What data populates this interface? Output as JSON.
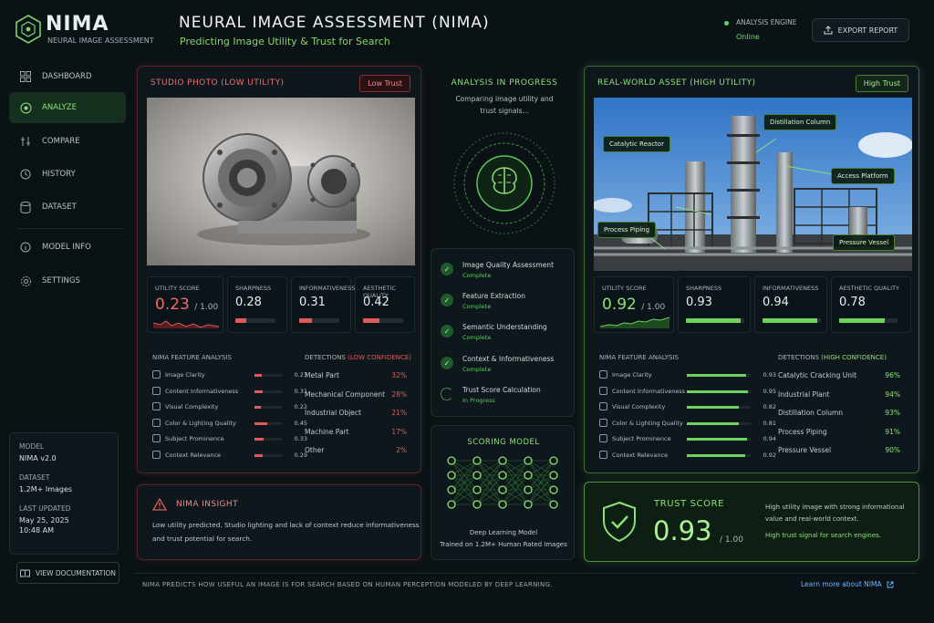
{
  "app": {
    "name": "NIMA",
    "subtitle": "NEURAL IMAGE ASSESSMENT"
  },
  "header": {
    "title": "NEURAL IMAGE ASSESSMENT (NIMA)",
    "subtitle": "Predicting Image Utility & Trust for Search",
    "engine_label": "ANALYSIS ENGINE",
    "engine_status": "Online",
    "export_label": "EXPORT REPORT"
  },
  "sidebar": {
    "items": [
      {
        "label": "DASHBOARD",
        "icon": "grid-icon"
      },
      {
        "label": "ANALYZE",
        "icon": "target-icon",
        "active": true
      },
      {
        "label": "COMPARE",
        "icon": "compare-icon"
      },
      {
        "label": "HISTORY",
        "icon": "history-icon"
      },
      {
        "label": "DATASET",
        "icon": "database-icon"
      },
      {
        "label": "MODEL INFO",
        "icon": "info-icon"
      },
      {
        "label": "SETTINGS",
        "icon": "gear-icon"
      }
    ],
    "model_label": "MODEL",
    "model_value": "NIMA v2.0",
    "dataset_label": "DATASET",
    "dataset_value": "1.2M+ Images",
    "updated_label": "LAST UPDATED",
    "updated_date": "May 25, 2025",
    "updated_time": "10:48 AM",
    "doc_button": "VIEW DOCUMENTATION"
  },
  "left_card": {
    "title": "STUDIO PHOTO (LOW UTILITY)",
    "tag": "Low Trust",
    "utility_label": "UTILITY SCORE",
    "utility_value": "0.23",
    "utility_max": "/ 1.00",
    "metrics": [
      {
        "label": "SHARPNESS",
        "value": "0.28",
        "fill": 0.28
      },
      {
        "label": "INFORMATIVENESS",
        "value": "0.31",
        "fill": 0.31
      },
      {
        "label": "AESTHETIC QUALITY",
        "value": "0.42",
        "fill": 0.42
      }
    ],
    "features_title": "NIMA FEATURE ANALYSIS",
    "features": [
      {
        "name": "Image Clarity",
        "value": "0.27",
        "fill": 0.27
      },
      {
        "name": "Content Informativeness",
        "value": "0.31",
        "fill": 0.31
      },
      {
        "name": "Visual Complexity",
        "value": "0.22",
        "fill": 0.22
      },
      {
        "name": "Color & Lighting Quality",
        "value": "0.45",
        "fill": 0.45
      },
      {
        "name": "Subject Prominence",
        "value": "0.33",
        "fill": 0.33
      },
      {
        "name": "Context Relevance",
        "value": "0.29",
        "fill": 0.29
      }
    ],
    "detections_title": "DETECTIONS",
    "detections_conf": "(LOW CONFIDENCE)",
    "detections": [
      {
        "name": "Metal Part",
        "pct": "32%"
      },
      {
        "name": "Mechanical Component",
        "pct": "28%"
      },
      {
        "name": "Industrial Object",
        "pct": "21%"
      },
      {
        "name": "Machine Part",
        "pct": "17%"
      },
      {
        "name": "Other",
        "pct": "2%"
      }
    ]
  },
  "insight": {
    "title": "NIMA INSIGHT",
    "line1": "Low utility predicted. Studio lighting and lack of context reduce informativeness",
    "line2": "and trust potential for search."
  },
  "center": {
    "title": "ANALYSIS IN PROGRESS",
    "sub1": "Comparing image utility and",
    "sub2": "trust signals...",
    "steps": [
      {
        "name": "Image Quality Assessment",
        "status": "Complete"
      },
      {
        "name": "Feature Extraction",
        "status": "Complete"
      },
      {
        "name": "Semantic Understanding",
        "status": "Complete"
      },
      {
        "name": "Context & Informativeness",
        "status": "Complete"
      },
      {
        "name": "Trust Score Calculation",
        "status": "In Progress"
      }
    ],
    "scoring_title": "SCORING MODEL",
    "scoring_sub1": "Deep Learning Model",
    "scoring_sub2": "Trained on 1.2M+ Human Rated Images"
  },
  "right_card": {
    "title": "REAL-WORLD ASSET (HIGH UTILITY)",
    "tag": "High Trust",
    "callouts": [
      "Distillation Column",
      "Catalytic Reactor",
      "Access Platform",
      "Process Piping",
      "Pressure Vessel"
    ],
    "utility_label": "UTILITY SCORE",
    "utility_value": "0.92",
    "utility_max": "/ 1.00",
    "metrics": [
      {
        "label": "SHARPNESS",
        "value": "0.93",
        "fill": 0.93
      },
      {
        "label": "INFORMATIVENESS",
        "value": "0.94",
        "fill": 0.94
      },
      {
        "label": "AESTHETIC QUALITY",
        "value": "0.78",
        "fill": 0.78
      }
    ],
    "features_title": "NIMA FEATURE ANALYSIS",
    "features": [
      {
        "name": "Image Clarity",
        "value": "0.93",
        "fill": 0.93
      },
      {
        "name": "Content Informativeness",
        "value": "0.95",
        "fill": 0.95
      },
      {
        "name": "Visual Complexity",
        "value": "0.82",
        "fill": 0.82
      },
      {
        "name": "Color & Lighting Quality",
        "value": "0.81",
        "fill": 0.81
      },
      {
        "name": "Subject Prominence",
        "value": "0.94",
        "fill": 0.94
      },
      {
        "name": "Context Relevance",
        "value": "0.92",
        "fill": 0.92
      }
    ],
    "detections_title": "DETECTIONS",
    "detections_conf": "(HIGH CONFIDENCE)",
    "detections": [
      {
        "name": "Catalytic Cracking Unit",
        "pct": "96%"
      },
      {
        "name": "Industrial Plant",
        "pct": "94%"
      },
      {
        "name": "Distillation Column",
        "pct": "93%"
      },
      {
        "name": "Process Piping",
        "pct": "91%"
      },
      {
        "name": "Pressure Vessel",
        "pct": "90%"
      }
    ]
  },
  "trust": {
    "label": "TRUST SCORE",
    "value": "0.93",
    "max": "/ 1.00",
    "line1": "High utility image with strong informational",
    "line2": "value and real-world context.",
    "highlight": "High trust signal for search engines."
  },
  "footer": {
    "text": "NIMA PREDICTS HOW USEFUL AN IMAGE IS FOR SEARCH BASED ON HUMAN PERCEPTION MODELED BY DEEP LEARNING.",
    "link": "Learn more about NIMA"
  },
  "colors": {
    "accent_green": "#8fe07a",
    "accent_red": "#e05a5a",
    "bg": "#0a1216"
  }
}
